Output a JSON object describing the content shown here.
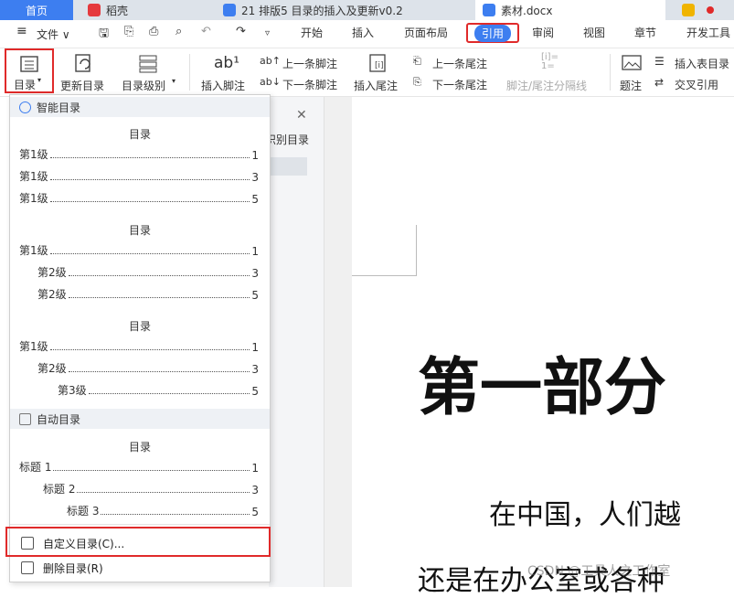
{
  "tabs": [
    {
      "label": "首页"
    },
    {
      "label": "稻壳"
    },
    {
      "label": "21 排版5 目录的插入及更新v0.2"
    },
    {
      "label": "素材.docx"
    }
  ],
  "menubar": {
    "file": "文件",
    "ribbon_tabs": [
      "开始",
      "插入",
      "页面布局",
      "引用",
      "审阅",
      "视图",
      "章节",
      "开发工具"
    ]
  },
  "ribbon": {
    "toc": "目录",
    "update_toc": "更新目录",
    "toc_level": "目录级别",
    "insert_footnote": "插入脚注",
    "prev_footnote": "上一条脚注",
    "next_footnote": "下一条脚注",
    "insert_endnote": "插入尾注",
    "prev_endnote": "上一条尾注",
    "next_endnote": "下一条尾注",
    "separator": "脚注/尾注分隔线",
    "caption": "题注",
    "insert_table_toc": "插入表目录",
    "cross_ref": "交叉引用"
  },
  "dropdown": {
    "smart_section": "智能目录",
    "auto_section": "自动目录",
    "toc_title": "目录",
    "preset1": [
      {
        "label": "第1级",
        "page": "1"
      },
      {
        "label": "第1级",
        "page": "3"
      },
      {
        "label": "第1级",
        "page": "5"
      }
    ],
    "preset2": [
      {
        "label": "第1级",
        "page": "1"
      },
      {
        "label": "第2级",
        "page": "3"
      },
      {
        "label": "第2级",
        "page": "5"
      }
    ],
    "preset3": [
      {
        "label": "第1级",
        "page": "1"
      },
      {
        "label": "第2级",
        "page": "3"
      },
      {
        "label": "第3级",
        "page": "5"
      }
    ],
    "auto": [
      {
        "label": "标题 1",
        "page": "1"
      },
      {
        "label": "标题 2",
        "page": "3"
      },
      {
        "label": "标题 3",
        "page": "5"
      }
    ],
    "custom_toc": "自定义目录(C)...",
    "delete_toc": "删除目录(R)"
  },
  "navpane": {
    "label": "识别目录"
  },
  "document": {
    "heading": "第一部分",
    "para1": "在中国，人们越",
    "para2": "还是在办公室或各种"
  },
  "watermark": "CSDN @工具人之工作室",
  "colors": {
    "accent": "#3d7ef0",
    "highlight": "#e02a2a"
  }
}
